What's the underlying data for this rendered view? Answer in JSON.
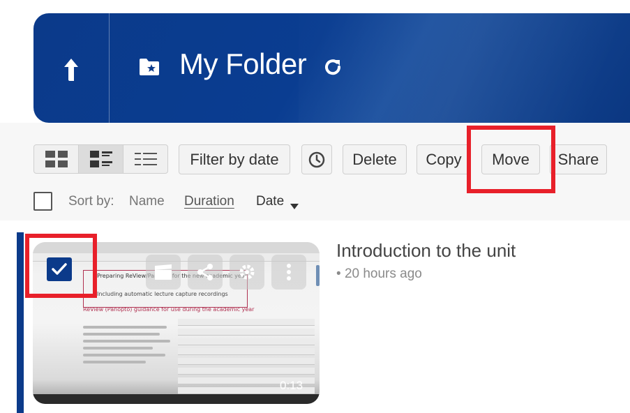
{
  "header": {
    "title": "My Folder",
    "up_icon": "up-arrow-icon",
    "folder_icon": "folder-star-icon",
    "refresh_icon": "refresh-icon",
    "colors": {
      "background": "#0b3a8a",
      "text": "#ffffff"
    }
  },
  "toolbar": {
    "views": [
      {
        "name": "tile-view-icon"
      },
      {
        "name": "detail-view-icon",
        "active": true
      },
      {
        "name": "list-view-icon"
      }
    ],
    "filter_label": "Filter by date",
    "recent_icon": "clock-icon",
    "delete_label": "Delete",
    "copy_label": "Copy",
    "move_label": "Move",
    "share_label": "Share",
    "highlight_color": "#e8202a"
  },
  "sort": {
    "label": "Sort by:",
    "name": "Name",
    "duration": "Duration",
    "date": "Date",
    "date_icon": "caret-down-icon"
  },
  "item": {
    "title": "Introduction to the unit",
    "meta": "20 hours ago",
    "duration": "0:13",
    "selected": true,
    "thumb": {
      "doc_title": "Preparing ReView/Panopto for the new academic year",
      "doc_subtitle": "Including automatic lecture capture recordings",
      "doc_section": "ReView (Panopto) guidance for use during the academic year"
    },
    "overlay_icons": [
      "edit-clapper-icon",
      "share-icon",
      "settings-gear-icon",
      "more-vertical-icon"
    ]
  }
}
